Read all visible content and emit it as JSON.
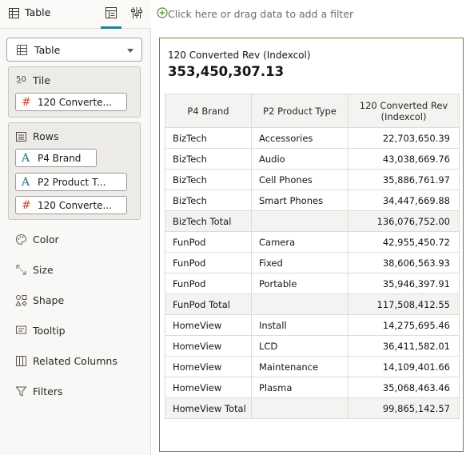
{
  "panel": {
    "title": "Table",
    "tab_icons": [
      "grammar-icon",
      "properties-icon"
    ]
  },
  "viz_type": {
    "label": "Table"
  },
  "tile_section": {
    "label": "Tile",
    "items": [
      {
        "label": "120 Converte...",
        "kind": "measure"
      }
    ]
  },
  "rows_section": {
    "label": "Rows",
    "items": [
      {
        "label": "P4 Brand",
        "kind": "attribute"
      },
      {
        "label": "P2 Product T...",
        "kind": "attribute"
      },
      {
        "label": "120 Converte...",
        "kind": "measure"
      }
    ]
  },
  "properties": [
    {
      "label": "Color",
      "icon": "palette-icon"
    },
    {
      "label": "Size",
      "icon": "size-icon"
    },
    {
      "label": "Shape",
      "icon": "shape-icon"
    },
    {
      "label": "Tooltip",
      "icon": "tooltip-icon"
    },
    {
      "label": "Related Columns",
      "icon": "columns-icon"
    },
    {
      "label": "Filters",
      "icon": "filter-icon"
    }
  ],
  "filter_bar": {
    "text": "Click here or drag data to add a filter"
  },
  "tile": {
    "label": "120 Converted Rev (Indexcol)",
    "value": "353,450,307.13"
  },
  "table": {
    "headers": [
      "P4 Brand",
      "P2 Product Type",
      "120 Converted Rev (Indexcol)"
    ],
    "rows": [
      {
        "brand": "BizTech",
        "type": "Accessories",
        "value": "22,703,650.39",
        "total": false
      },
      {
        "brand": "BizTech",
        "type": "Audio",
        "value": "43,038,669.76",
        "total": false
      },
      {
        "brand": "BizTech",
        "type": "Cell Phones",
        "value": "35,886,761.97",
        "total": false
      },
      {
        "brand": "BizTech",
        "type": "Smart Phones",
        "value": "34,447,669.88",
        "total": false
      },
      {
        "brand": "BizTech Total",
        "type": "",
        "value": "136,076,752.00",
        "total": true
      },
      {
        "brand": "FunPod",
        "type": "Camera",
        "value": "42,955,450.72",
        "total": false
      },
      {
        "brand": "FunPod",
        "type": "Fixed",
        "value": "38,606,563.93",
        "total": false
      },
      {
        "brand": "FunPod",
        "type": "Portable",
        "value": "35,946,397.91",
        "total": false
      },
      {
        "brand": "FunPod Total",
        "type": "",
        "value": "117,508,412.55",
        "total": true
      },
      {
        "brand": "HomeView",
        "type": "Install",
        "value": "14,275,695.46",
        "total": false
      },
      {
        "brand": "HomeView",
        "type": "LCD",
        "value": "36,411,582.01",
        "total": false
      },
      {
        "brand": "HomeView",
        "type": "Maintenance",
        "value": "14,109,401.66",
        "total": false
      },
      {
        "brand": "HomeView",
        "type": "Plasma",
        "value": "35,068,463.46",
        "total": false
      },
      {
        "brand": "HomeView Total",
        "type": "",
        "value": "99,865,142.57",
        "total": true
      }
    ]
  },
  "colors": {
    "accent": "#227e9e",
    "measure": "#c74634",
    "attribute": "#2d6e85",
    "canvas_border": "#5f8a3c",
    "add_icon": "#4c8c2b"
  }
}
